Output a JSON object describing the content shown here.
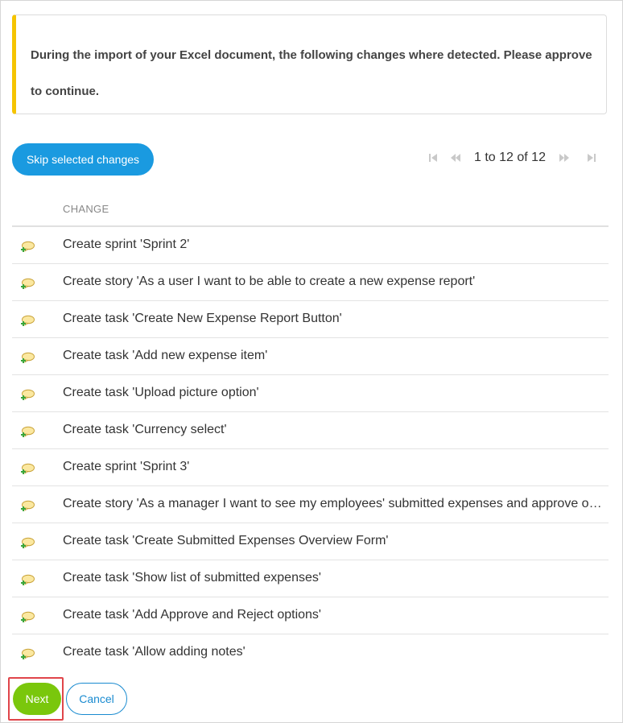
{
  "notice": {
    "text": "During the import of your Excel document, the following changes where detected. Please approve to continue.",
    "accent_color": "#f5c400"
  },
  "toolbar": {
    "skip_label": "Skip selected changes"
  },
  "pager": {
    "text": "1 to 12 of 12"
  },
  "table": {
    "column_header": "CHANGE",
    "icon": "comment-add-icon",
    "rows": [
      "Create sprint 'Sprint 2'",
      "Create story 'As a user I want to be able to create a new expense report'",
      "Create task 'Create New Expense Report Button'",
      "Create task 'Add new expense item'",
      "Create task 'Upload picture option'",
      "Create task 'Currency select'",
      "Create sprint 'Sprint 3'",
      "Create story 'As a manager I want to see my employees' submitted expenses and approve or reject them'",
      "Create task 'Create Submitted Expenses Overview Form'",
      "Create task 'Show list of submitted expenses'",
      "Create task 'Add Approve and Reject options'",
      "Create task 'Allow adding notes'"
    ]
  },
  "footer": {
    "next_label": "Next",
    "cancel_label": "Cancel"
  },
  "colors": {
    "primary": "#1a9ae0",
    "next": "#7ac70c",
    "highlight": "#e0454a"
  }
}
